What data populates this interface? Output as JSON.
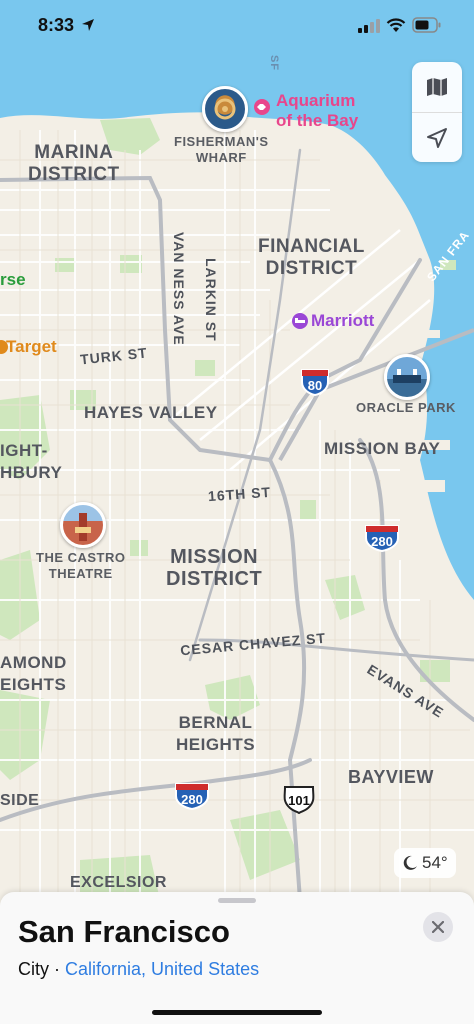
{
  "status_bar": {
    "time": "8:33"
  },
  "map": {
    "neighborhoods": [
      {
        "id": "marina",
        "lines": [
          "MARINA",
          "DISTRICT"
        ]
      },
      {
        "id": "financial",
        "lines": [
          "FINANCIAL",
          "DISTRICT"
        ]
      },
      {
        "id": "hayes",
        "lines": [
          "HAYES VALLEY"
        ]
      },
      {
        "id": "missionbay",
        "lines": [
          "MISSION BAY"
        ]
      },
      {
        "id": "haight",
        "lines": [
          "IGHT-",
          "HBURY"
        ]
      },
      {
        "id": "mission",
        "lines": [
          "MISSION",
          "DISTRICT"
        ]
      },
      {
        "id": "diamond",
        "lines": [
          "AMOND",
          "EIGHTS"
        ]
      },
      {
        "id": "bernal",
        "lines": [
          "BERNAL",
          "HEIGHTS"
        ]
      },
      {
        "id": "bayview",
        "lines": [
          "BAYVIEW"
        ]
      },
      {
        "id": "side",
        "lines": [
          "SIDE"
        ]
      },
      {
        "id": "excelsior",
        "lines": [
          "EXCELSIOR"
        ]
      }
    ],
    "streets": {
      "van_ness": "VAN NESS AVE",
      "larkin": "LARKIN ST",
      "turk": "TURK ST",
      "sixteenth": "16TH ST",
      "cesar_chavez": "CESAR CHAVEZ ST",
      "evans": "EVANS AVE",
      "san_fran": "SAN FRA",
      "sf_top": "SF"
    },
    "landmarks": {
      "fishermans": [
        "FISHERMAN'S",
        "WHARF"
      ],
      "oracle": [
        "ORACLE PARK"
      ],
      "castro": [
        "THE CASTRO",
        "THEATRE"
      ]
    },
    "pois": {
      "aquarium": [
        "Aquarium",
        "of the Bay"
      ],
      "marriott": "Marriott",
      "target": "Target",
      "erse": "rse"
    },
    "highways": {
      "i80": "80",
      "i280_a": "280",
      "i280_b": "280",
      "us101": "101"
    },
    "colors": {
      "water": "#79c7ee",
      "land": "#f3efe6",
      "park": "#cfe7bd",
      "aquarium": "#e8468c",
      "marriott": "#9a47d6",
      "target": "#e08a1c",
      "interstate": "#2561b5"
    }
  },
  "weather": {
    "temp": "54°"
  },
  "place_sheet": {
    "title": "San Francisco",
    "category": "City",
    "separator": " · ",
    "region": "California, United States"
  }
}
